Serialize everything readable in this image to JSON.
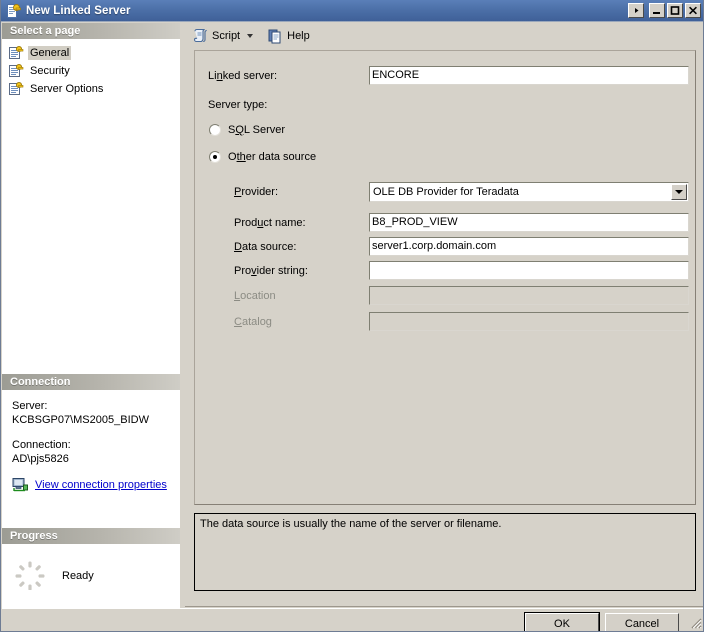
{
  "window": {
    "title": "New Linked Server",
    "title_icon": "linked-server-key-icon",
    "buttons": [
      {
        "name": "context-arrow",
        "glyph": "▸"
      },
      {
        "name": "minimize",
        "glyph": "–"
      },
      {
        "name": "maximize",
        "glyph": "□"
      },
      {
        "name": "close",
        "glyph": "✕"
      }
    ]
  },
  "sidebar": {
    "select_page_header": "Select a page",
    "items": [
      {
        "label": "General",
        "icon": "page-key-icon",
        "selected": true
      },
      {
        "label": "Security",
        "icon": "page-key-icon",
        "selected": false
      },
      {
        "label": "Server Options",
        "icon": "page-key-icon",
        "selected": false
      }
    ],
    "connection": {
      "header": "Connection",
      "server_label": "Server:",
      "server_value": "KCBSGP07\\MS2005_BIDW",
      "connection_label": "Connection:",
      "connection_value": "AD\\pjs5826",
      "link_text": "View connection properties",
      "link_icon": "computer-connection-icon",
      "link_color": "#0000cc"
    },
    "progress": {
      "header": "Progress",
      "status": "Ready",
      "icon": "spinner-ring-icon"
    }
  },
  "toolbar": {
    "script_label": "Script",
    "script_icon": "script-scroll-icon",
    "script_has_dropdown": true,
    "help_label": "Help",
    "help_icon": "help-document-icon"
  },
  "form": {
    "linked_server_label": "Linked server:",
    "linked_server_accel": "n",
    "linked_server_value": "ENCORE",
    "server_type_label": "Server type:",
    "radios": [
      {
        "label": "SQL Server",
        "accel": "Q",
        "checked": false,
        "name": "sql-server"
      },
      {
        "label": "Other data source",
        "accel": "th",
        "checked": true,
        "name": "other-data-source"
      }
    ],
    "fields": [
      {
        "name": "provider",
        "label": "Provider:",
        "accel": "P",
        "type": "combo",
        "value": "OLE DB Provider for Teradata",
        "disabled": false
      },
      {
        "name": "product-name",
        "label": "Product name:",
        "accel": "u",
        "type": "text",
        "value": "B8_PROD_VIEW",
        "disabled": false
      },
      {
        "name": "data-source",
        "label": "Data source:",
        "accel": "D",
        "type": "text",
        "value": "server1.corp.domain.com",
        "disabled": false
      },
      {
        "name": "provider-string",
        "label": "Provider string:",
        "accel": "v",
        "type": "text",
        "value": "",
        "disabled": false
      },
      {
        "name": "location",
        "label": "Location",
        "accel": "L",
        "type": "text",
        "value": "",
        "disabled": true
      },
      {
        "name": "catalog",
        "label": "Catalog",
        "accel": "C",
        "type": "text",
        "value": "",
        "disabled": true
      }
    ]
  },
  "description": {
    "text": "The data source is usually the name of the server or filename."
  },
  "footer": {
    "ok_label": "OK",
    "cancel_label": "Cancel"
  },
  "colors": {
    "titlebar_start": "#5a7fb8",
    "titlebar_end": "#3f6098",
    "dialog_face": "#d6d2c9",
    "selection": "#d2cec4",
    "link": "#0000cc"
  }
}
